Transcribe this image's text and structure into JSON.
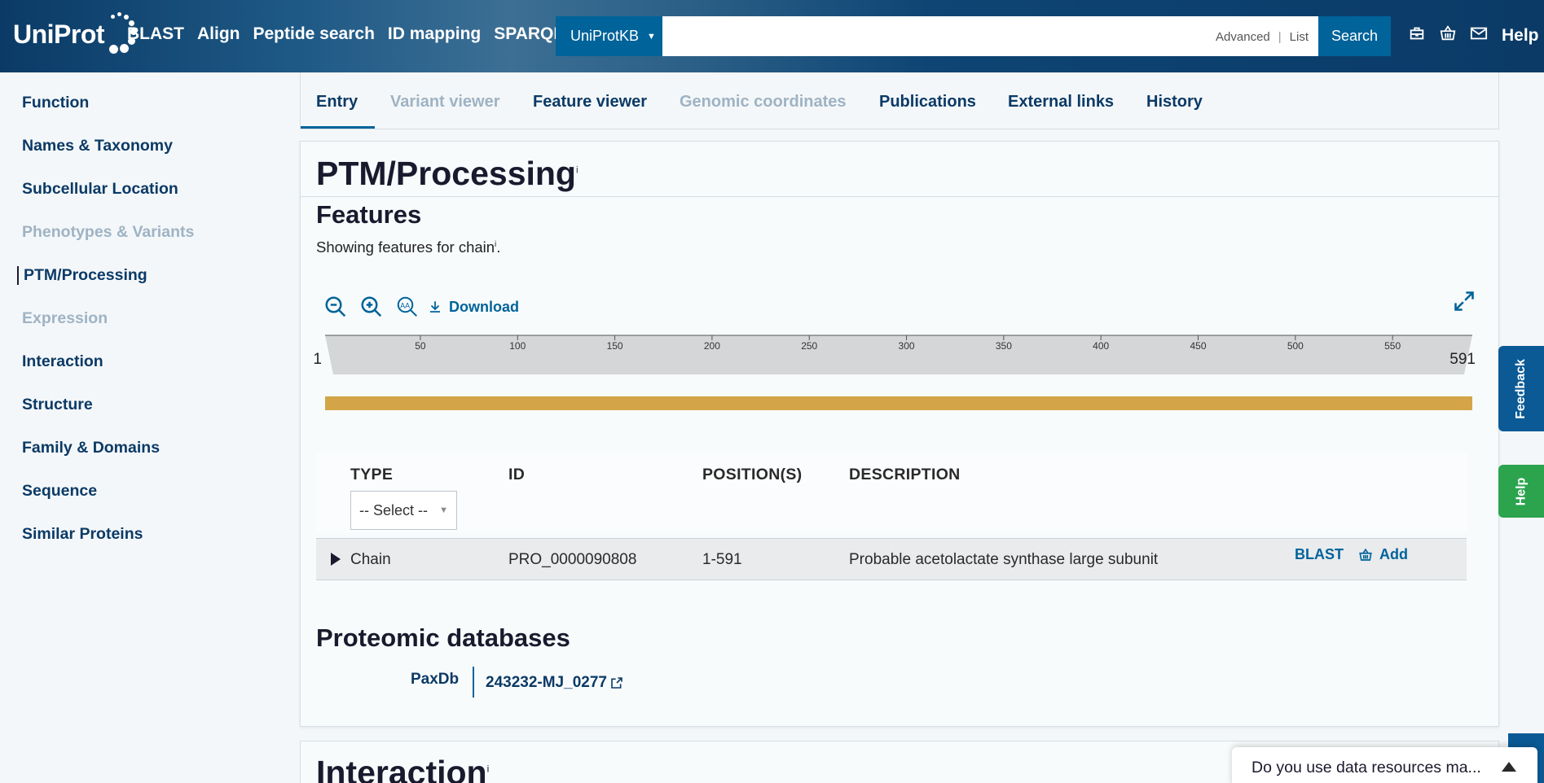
{
  "header": {
    "logo": "UniProt",
    "nav": [
      "BLAST",
      "Align",
      "Peptide search",
      "ID mapping",
      "SPARQL"
    ],
    "db_select": "UniProtKB",
    "search_value": "",
    "search_links": [
      "Advanced",
      "List"
    ],
    "search_button": "Search",
    "icons": [
      "toolkit-icon",
      "basket-icon",
      "mail-icon"
    ],
    "help": "Help"
  },
  "sidebar": {
    "items": [
      {
        "label": "Function",
        "state": "normal"
      },
      {
        "label": "Names & Taxonomy",
        "state": "normal"
      },
      {
        "label": "Subcellular Location",
        "state": "normal"
      },
      {
        "label": "Phenotypes & Variants",
        "state": "disabled"
      },
      {
        "label": "PTM/Processing",
        "state": "active"
      },
      {
        "label": "Expression",
        "state": "disabled"
      },
      {
        "label": "Interaction",
        "state": "normal"
      },
      {
        "label": "Structure",
        "state": "normal"
      },
      {
        "label": "Family & Domains",
        "state": "normal"
      },
      {
        "label": "Sequence",
        "state": "normal"
      },
      {
        "label": "Similar Proteins",
        "state": "normal"
      }
    ]
  },
  "tabs": [
    {
      "label": "Entry",
      "state": "active"
    },
    {
      "label": "Variant viewer",
      "state": "disabled"
    },
    {
      "label": "Feature viewer",
      "state": "normal"
    },
    {
      "label": "Genomic coordinates",
      "state": "disabled"
    },
    {
      "label": "Publications",
      "state": "normal"
    },
    {
      "label": "External links",
      "state": "normal"
    },
    {
      "label": "History",
      "state": "normal"
    }
  ],
  "section": {
    "title": "PTM/Processing",
    "info_marker": "i",
    "features_title": "Features",
    "showing_text_prefix": "Showing features for chain",
    "showing_text_suffix": ".",
    "download": "Download",
    "ruler": {
      "start": "1",
      "end": "591",
      "ticks": [
        "50",
        "100",
        "150",
        "200",
        "250",
        "300",
        "350",
        "400",
        "450",
        "500",
        "550"
      ],
      "min": 1,
      "max": 591
    },
    "feature_color": "#d3a548",
    "table": {
      "headers": [
        "TYPE",
        "ID",
        "POSITION(S)",
        "DESCRIPTION"
      ],
      "type_filter": "-- Select --",
      "rows": [
        {
          "type": "Chain",
          "id": "PRO_0000090808",
          "positions": "1-591",
          "description": "Probable acetolactate synthase large subunit",
          "blast": "BLAST",
          "add": "Add"
        }
      ]
    },
    "proteomic_title": "Proteomic databases",
    "xref": {
      "db": "PaxDb",
      "value": "243232-MJ_0277"
    }
  },
  "next_section": {
    "title": "Interaction",
    "info_marker": "i"
  },
  "side_tabs": {
    "feedback": "Feedback",
    "help": "Help"
  },
  "survey": {
    "text": "Do you use data resources ma..."
  },
  "colors": {
    "brand_dark": "#0b3a66",
    "accent": "#00639a",
    "feedback": "#0b5a96",
    "help_green": "#2ca44e"
  }
}
